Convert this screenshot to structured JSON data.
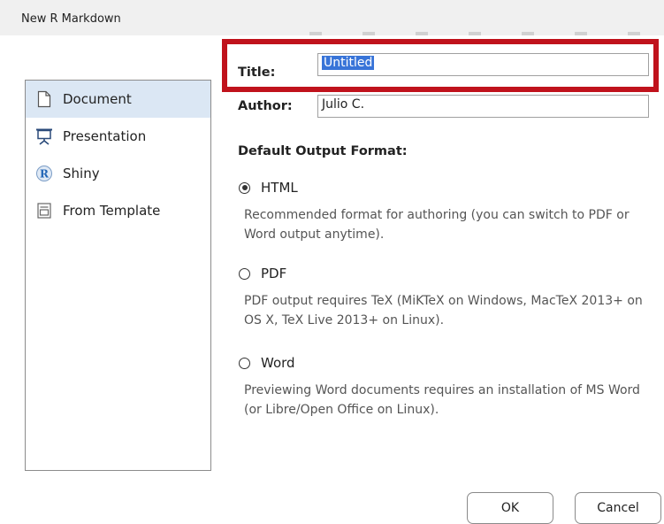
{
  "window": {
    "title": "New R Markdown"
  },
  "sidebar": {
    "items": [
      {
        "label": "Document",
        "icon": "document-icon",
        "selected": true
      },
      {
        "label": "Presentation",
        "icon": "presentation-icon",
        "selected": false
      },
      {
        "label": "Shiny",
        "icon": "shiny-r-icon",
        "selected": false
      },
      {
        "label": "From Template",
        "icon": "template-icon",
        "selected": false
      }
    ]
  },
  "form": {
    "title_label": "Title:",
    "title_value": "Untitled",
    "author_label": "Author:",
    "author_value": "Julio C.",
    "output_heading": "Default Output Format:",
    "formats": [
      {
        "label": "HTML",
        "selected": true,
        "description": "Recommended format for authoring (you can switch to PDF or Word output anytime)."
      },
      {
        "label": "PDF",
        "selected": false,
        "description": "PDF output requires TeX (MiKTeX on Windows, MacTeX 2013+ on OS X, TeX Live 2013+ on Linux)."
      },
      {
        "label": "Word",
        "selected": false,
        "description": "Previewing Word documents requires an installation of MS Word (or Libre/Open Office on Linux)."
      }
    ]
  },
  "buttons": {
    "ok": "OK",
    "cancel": "Cancel"
  },
  "colors": {
    "highlight_border": "#c0121c",
    "selection": "#3874d8",
    "sidebar_selected": "#dbe7f4"
  }
}
